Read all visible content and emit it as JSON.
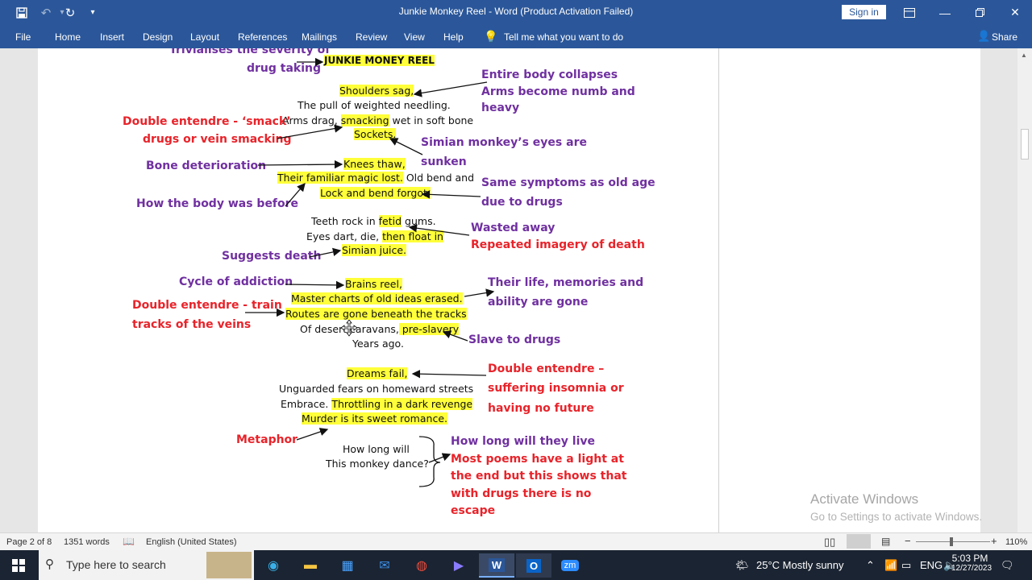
{
  "window": {
    "title": "Junkie Monkey Reel  -  Word (Product Activation Failed)",
    "sign_in": "Sign in"
  },
  "quick_access": {
    "save_icon": "save-icon",
    "undo_icon": "undo-icon",
    "redo_icon": "redo-icon"
  },
  "menu": [
    "File",
    "Home",
    "Insert",
    "Design",
    "Layout",
    "References",
    "Mailings",
    "Review",
    "View",
    "Help",
    "Tell me what you want to do",
    "Share"
  ],
  "document": {
    "poem": {
      "title": "JUNKIE MONEY REEL",
      "l1": "Shoulders sag,",
      "l2": "The pull of weighted needling.",
      "l3a": "Arms drag, ",
      "l3b": "smacking",
      "l3c": " wet in soft bone",
      "l4": "Sockets.",
      "l5": "Knees thaw,",
      "l6a": "Their familiar magic lost.",
      "l6b": " Old bend and",
      "l7": "Lock and bend forgot.",
      "l8a": "Teeth rock in ",
      "l8b": "fetid",
      "l8c": " gums.",
      "l9a": "Eyes dart, die, ",
      "l9b": "then float in",
      "l10": "Simian juice.",
      "l11": "Brains reel,",
      "l12": "Master charts of old ideas erased.",
      "l13": "Routes are gone beneath the tracks",
      "l14a": "Of desert caravans,",
      "l14b": " pre-slavery",
      "l15": "Years ago.",
      "l16": "Dreams fail,",
      "l17": "Unguarded fears on homeward streets",
      "l18a": "Embrace. ",
      "l18b": "Throttling in a dark revenge",
      "l19": "Murder is its sweet romance.",
      "l20": "How long will",
      "l21": "This monkey dance?"
    },
    "annotations": {
      "trivialises1": "Trivialises the severity of",
      "trivialises2": "drug taking",
      "entire1": "Entire body collapses",
      "entire2": "Arms become numb and",
      "entire3": "heavy",
      "double_smack1": "Double entendre - ‘smack’",
      "double_smack2": "drugs or vein smacking",
      "simian1": "Simian monkey’s eyes are",
      "simian2": "sunken",
      "bone": "Bone deterioration",
      "same1": "Same symptoms as old  age",
      "same2": "due to drugs",
      "how_body": "How the body was before",
      "wasted": "Wasted away",
      "repeated": "Repeated imagery of death",
      "suggests": "Suggests death",
      "cycle": "Cycle of addiction",
      "their1": "Their life, memories and",
      "their2": "ability are gone",
      "double_train1": "Double entendre - train",
      "double_train2": "tracks of the veins",
      "slave": "Slave to drugs",
      "double_insomnia1": "Double entendre –",
      "double_insomnia2": "suffering insomnia or",
      "double_insomnia3": "having no future",
      "metaphor": "Metaphor",
      "how_long": "How long will they live",
      "most1": "Most poems have a light at",
      "most2": "the end but this shows that",
      "most3": "with drugs there is no",
      "most4": "escape"
    }
  },
  "watermark": {
    "line1": "Activate Windows",
    "line2": "Go to Settings to activate Windows."
  },
  "status": {
    "page": "Page 2 of 8",
    "words": "1351 words",
    "language": "English (United States)",
    "zoom": "110%"
  },
  "taskbar": {
    "search_placeholder": "Type here to search",
    "weather": "25°C  Mostly sunny",
    "lang": "ENG",
    "time": "5:03 PM",
    "date": "12/27/2023"
  },
  "colors": {
    "word_blue": "#2b579a",
    "highlight": "#ffff3a",
    "purple": "#7030a0",
    "red": "#e8232a"
  }
}
